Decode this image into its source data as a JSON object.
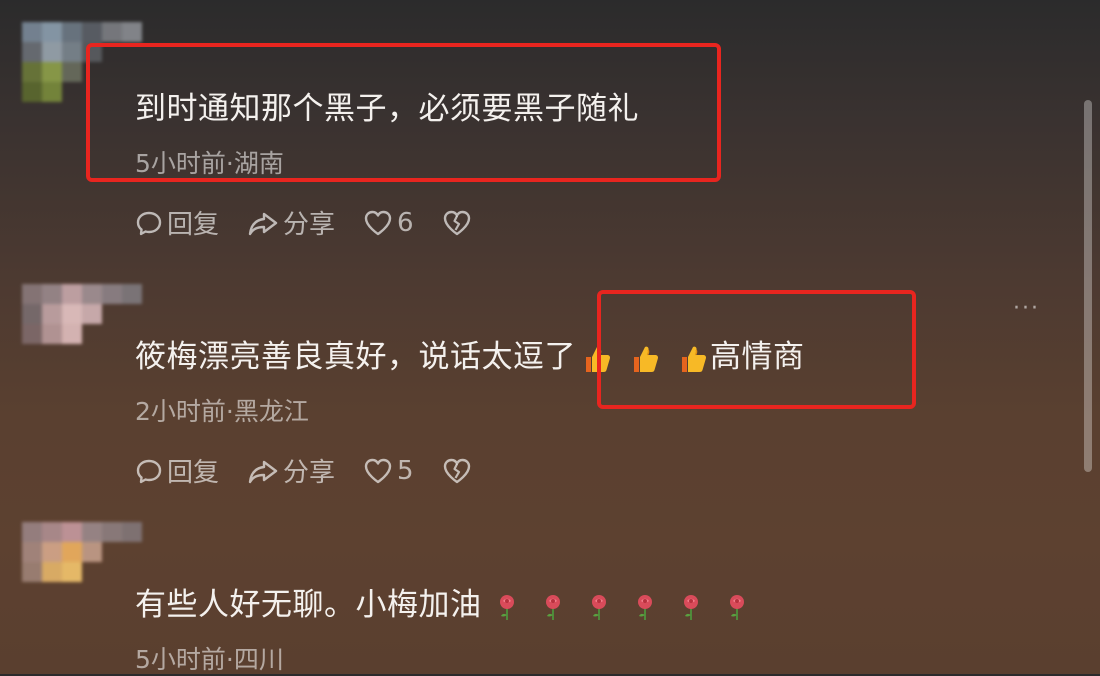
{
  "comments": [
    {
      "text": "到时通知那个黑子，必须要黑子随礼",
      "time": "5小时前",
      "location": "湖南",
      "meta": "5小时前·湖南",
      "reply_label": "回复",
      "share_label": "分享",
      "like_count": "6",
      "emojis": []
    },
    {
      "text": "筱梅漂亮善良真好，说话太逗了",
      "emojis": [
        "thumbs-up",
        "thumbs-up",
        "thumbs-up"
      ],
      "suffix": "高情商",
      "time": "2小时前",
      "location": "黑龙江",
      "meta": "2小时前·黑龙江",
      "reply_label": "回复",
      "share_label": "分享",
      "like_count": "5"
    },
    {
      "text": "有些人好无聊。小梅加油",
      "emojis": [
        "rose",
        "rose",
        "rose",
        "rose",
        "rose",
        "rose"
      ],
      "time": "5小时前",
      "location": "四川",
      "meta": "5小时前·四川"
    }
  ],
  "more_label": "···",
  "colors": {
    "highlight": "#e8251f",
    "text": "#f4f1ee",
    "meta": "rgba(255,255,255,0.55)"
  }
}
